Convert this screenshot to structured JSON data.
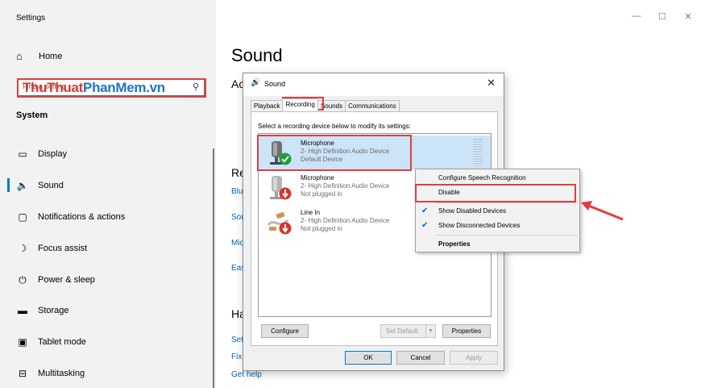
{
  "settings": {
    "app_title": "Settings",
    "home_label": "Home",
    "search_placeholder": "Find a setting",
    "watermark_part1": "ThuThuat",
    "watermark_part2": "PhanMem.vn",
    "system_heading": "System",
    "nav_items": [
      {
        "label": "Display",
        "icon": "monitor-icon"
      },
      {
        "label": "Sound",
        "icon": "speaker-icon"
      },
      {
        "label": "Notifications & actions",
        "icon": "notification-icon"
      },
      {
        "label": "Focus assist",
        "icon": "moon-icon"
      },
      {
        "label": "Power & sleep",
        "icon": "power-icon"
      },
      {
        "label": "Storage",
        "icon": "storage-icon"
      },
      {
        "label": "Tablet mode",
        "icon": "tablet-icon"
      },
      {
        "label": "Multitasking",
        "icon": "multitasking-icon"
      }
    ],
    "active_nav": "Sound",
    "window_controls": {
      "minimize": "—",
      "maximize": "☐",
      "close": "✕"
    }
  },
  "main": {
    "title": "Sound",
    "fragments": {
      "output_heading": "Ac",
      "related_heading": "Re",
      "help_heading": "Ha",
      "link_blu": "Blu",
      "link_sou": "Sou",
      "link_mic": "Mic",
      "link_eas": "Eas",
      "link_set": "Set",
      "link_fix": "Fix",
      "get_help": "Get help"
    }
  },
  "sound_dialog": {
    "title": "Sound",
    "tabs": [
      "Playback",
      "Recording",
      "Sounds",
      "Communications"
    ],
    "active_tab": "Recording",
    "instruction": "Select a recording device below to modify its settings:",
    "devices": [
      {
        "name": "Microphone",
        "detail": "2- High Definition Audio Device",
        "status": "Default Device",
        "icon": "microphone-icon",
        "badge": "check-badge-icon",
        "selected": true
      },
      {
        "name": "Microphone",
        "detail": "2- High Definition Audio Device",
        "status": "Not plugged in",
        "icon": "microphone-icon",
        "badge": "unplugged-badge-icon",
        "selected": false
      },
      {
        "name": "Line In",
        "detail": "2- High Definition Audio Device",
        "status": "Not plugged in",
        "icon": "line-in-cable-icon",
        "badge": "unplugged-badge-icon",
        "selected": false
      }
    ],
    "buttons": {
      "configure": "Configure",
      "set_default": "Set Default",
      "properties": "Properties",
      "ok": "OK",
      "cancel": "Cancel",
      "apply": "Apply"
    }
  },
  "context_menu": {
    "items": [
      {
        "label": "Configure Speech Recognition",
        "checked": false,
        "bold": false
      },
      {
        "label": "Disable",
        "checked": false,
        "bold": false
      },
      {
        "label": "Show Disabled Devices",
        "checked": true,
        "bold": false
      },
      {
        "label": "Show Disconnected Devices",
        "checked": true,
        "bold": false
      },
      {
        "label": "Properties",
        "checked": false,
        "bold": true
      }
    ],
    "check_glyph": "✔"
  },
  "colors": {
    "sidebar_bg": "#f2f2f2",
    "accent": "#0078d7",
    "link": "#0067b8",
    "highlight": "#e03e3e",
    "selected_row": "#cce4f7"
  }
}
